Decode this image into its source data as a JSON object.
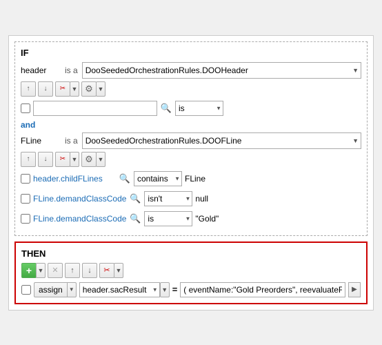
{
  "if_section": {
    "label": "IF",
    "row1": {
      "type_name": "header",
      "is_a": "is a",
      "class_value": "DooSeededOrchestrationRules.DOOHeader"
    },
    "toolbar1": {
      "buttons": [
        "up",
        "down",
        "scissors",
        "scissors-drop",
        "gear",
        "gear-drop"
      ]
    },
    "empty_condition": {
      "operator_value": "is"
    },
    "and_label": "and",
    "row2": {
      "type_name": "FLine",
      "is_a": "is a",
      "class_value": "DooSeededOrchestrationRules.DOOFLine"
    },
    "toolbar2": {
      "buttons": [
        "up",
        "down",
        "scissors",
        "scissors-drop",
        "gear",
        "gear-drop"
      ]
    },
    "conditions": [
      {
        "field": "header.childFLines",
        "operator": "contains",
        "value": "FLine"
      },
      {
        "field": "FLine.demandClassCode",
        "operator": "isn't",
        "value": "null"
      },
      {
        "field": "FLine.demandClassCode",
        "operator": "is",
        "value": "\"Gold\""
      }
    ]
  },
  "then_section": {
    "label": "THEN",
    "assign_row": {
      "assign_label": "assign",
      "field_value": "header.sacResult",
      "equals": "=",
      "expr_value": "( eventName:\"Gold Preorders\", reevaluateF"
    }
  }
}
